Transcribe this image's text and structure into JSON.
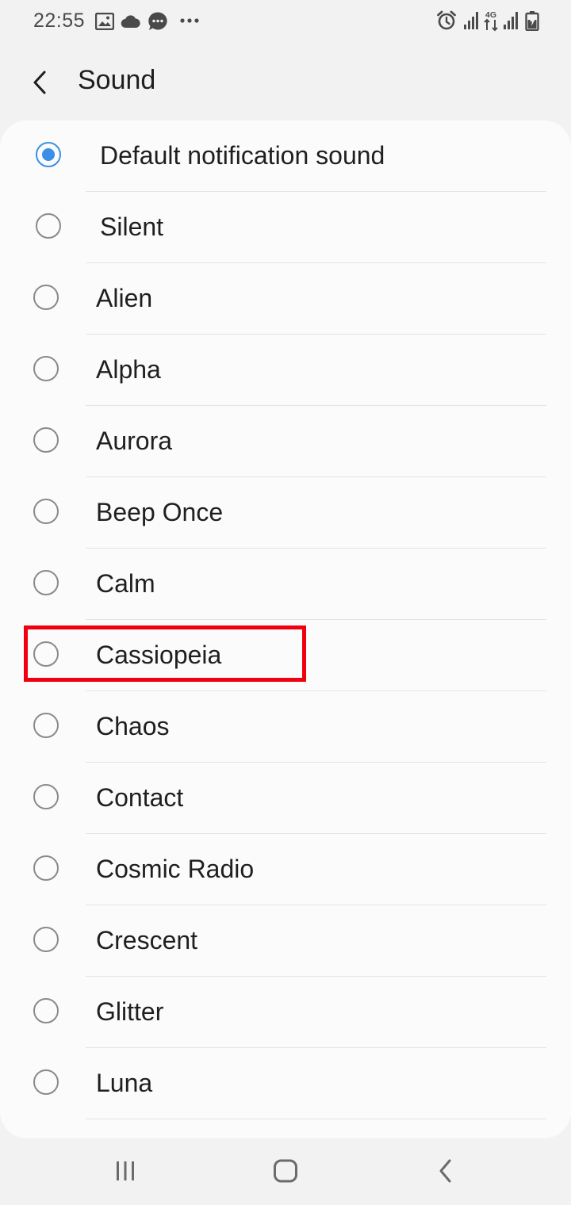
{
  "status_bar": {
    "time": "22:55",
    "left_icons": [
      "gallery-icon",
      "cloud-icon",
      "message-icon",
      "more-dots-icon"
    ],
    "right_icons": [
      "alarm-icon",
      "signal-icon",
      "network-4g-icon",
      "signal-icon",
      "battery-icon"
    ]
  },
  "header": {
    "title": "Sound",
    "back_icon": "chevron-left-icon"
  },
  "colors": {
    "accent": "#3b8fe6",
    "highlight": "#f0000f",
    "background": "#f2f2f2",
    "card": "#fbfbfb"
  },
  "sounds": [
    {
      "label": "Default notification sound",
      "selected": true
    },
    {
      "label": "Silent",
      "selected": false
    },
    {
      "label": "Alien",
      "selected": false
    },
    {
      "label": "Alpha",
      "selected": false
    },
    {
      "label": "Aurora",
      "selected": false
    },
    {
      "label": "Beep Once",
      "selected": false
    },
    {
      "label": "Calm",
      "selected": false
    },
    {
      "label": "Cassiopeia",
      "selected": false
    },
    {
      "label": "Chaos",
      "selected": false
    },
    {
      "label": "Contact",
      "selected": false
    },
    {
      "label": "Cosmic Radio",
      "selected": false
    },
    {
      "label": "Crescent",
      "selected": false
    },
    {
      "label": "Glitter",
      "selected": false
    },
    {
      "label": "Luna",
      "selected": false
    }
  ],
  "highlighted_item": "Cassiopeia",
  "nav_bar": {
    "buttons": [
      "recent-apps-icon",
      "home-icon",
      "back-icon"
    ]
  }
}
